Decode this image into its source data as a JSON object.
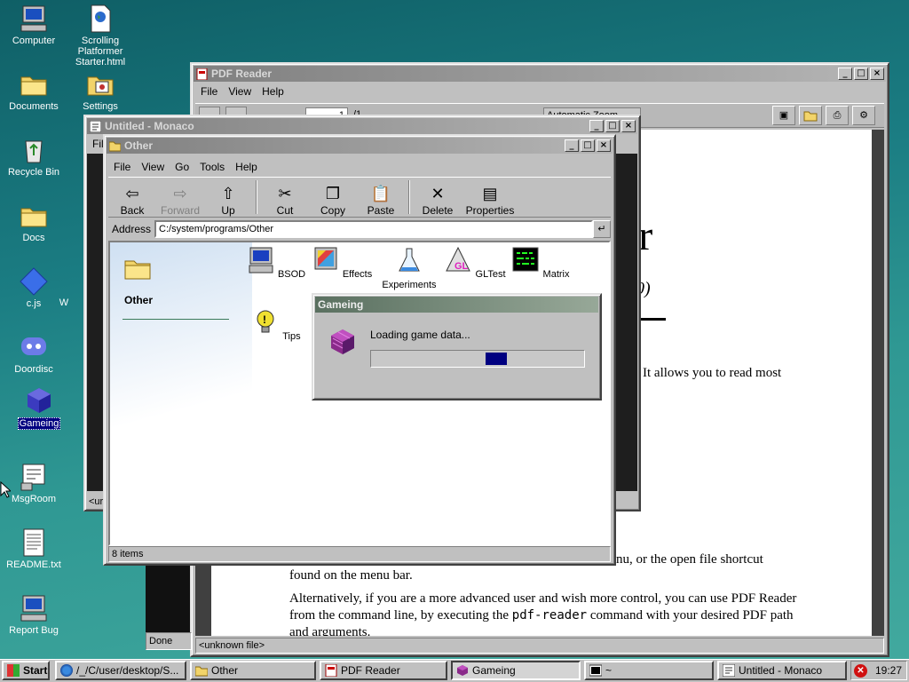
{
  "desktop": {
    "icons": [
      {
        "label": "Computer",
        "icon": "computer-icon"
      },
      {
        "label": "Scrolling Platformer Starter.html",
        "icon": "html-file-icon"
      },
      {
        "label": "Documents",
        "icon": "folder-icon"
      },
      {
        "label": "Settings",
        "icon": "settings-icon"
      },
      {
        "label": "Recycle Bin",
        "icon": "recycle-bin-icon"
      },
      {
        "label": "Docs",
        "icon": "folder-icon"
      },
      {
        "label": "c.js",
        "icon": "js-file-icon"
      },
      {
        "label": "Doordisc",
        "icon": "chat-icon"
      },
      {
        "label": "Gameing",
        "icon": "cube-icon"
      },
      {
        "label": "MsgRoom",
        "icon": "msgroom-icon"
      },
      {
        "label": "README.txt",
        "icon": "text-file-icon"
      },
      {
        "label": "Report Bug",
        "icon": "report-icon"
      }
    ],
    "partial_text": "W"
  },
  "pdf_reader": {
    "title": "PDF Reader",
    "menu": [
      "File",
      "View",
      "Help"
    ],
    "page_input": "1",
    "page_count": "/1",
    "zoom": "Automatic Zoom",
    "doc": {
      "big_title_fragment": "er",
      "subtitle_fragment": "0)",
      "line1": "It allows you to read most",
      "line2": "nu, or the open file shortcut",
      "line3": "found on the menu bar.",
      "para2_l1": "Alternatively, if you are a more advanced user and wish more control, you can use PDF Reader",
      "para2_l2a": "from the command line, by executing the ",
      "para2_code": "pdf-reader",
      "para2_l2b": " command with your desired PDF path",
      "para2_l3": "and arguments."
    },
    "status": "<unknown file>"
  },
  "monaco": {
    "title": "Untitled - Monaco",
    "menu_partial": "File",
    "status_partial": "<ur",
    "done": "Done"
  },
  "explorer": {
    "title": "Other",
    "menu": [
      "File",
      "View",
      "Go",
      "Tools",
      "Help"
    ],
    "toolbar": [
      {
        "label": "Back",
        "icon": "back-arrow-icon",
        "enabled": true
      },
      {
        "label": "Forward",
        "icon": "forward-arrow-icon",
        "enabled": false
      },
      {
        "label": "Up",
        "icon": "up-folder-icon",
        "enabled": true
      },
      {
        "label": "Cut",
        "icon": "scissors-icon",
        "enabled": true
      },
      {
        "label": "Copy",
        "icon": "copy-icon",
        "enabled": true
      },
      {
        "label": "Paste",
        "icon": "paste-icon",
        "enabled": true
      },
      {
        "label": "Delete",
        "icon": "delete-x-icon",
        "enabled": true
      },
      {
        "label": "Properties",
        "icon": "properties-icon",
        "enabled": true
      }
    ],
    "address_label": "Address",
    "address": "C:/system/programs/Other",
    "sidebar_title": "Other",
    "items": [
      {
        "label": "BSOD",
        "icon": "bsod-icon"
      },
      {
        "label": "Effects",
        "icon": "effects-icon"
      },
      {
        "label": "Experiments",
        "icon": "flask-icon"
      },
      {
        "label": "GLTest",
        "icon": "gl-icon"
      },
      {
        "label": "Matrix",
        "icon": "matrix-icon"
      },
      {
        "label": "Tips",
        "icon": "tips-icon"
      }
    ],
    "status": "8 items"
  },
  "loading_dialog": {
    "title": "Gameing",
    "message": "Loading game data...",
    "progress": 0.5
  },
  "taskbar": {
    "start": "Start",
    "tasks": [
      {
        "label": "/_/C/user/desktop/S...",
        "icon": "browser-icon"
      },
      {
        "label": "Other",
        "icon": "folder-icon"
      },
      {
        "label": "PDF Reader",
        "icon": "pdf-icon"
      },
      {
        "label": "Gameing",
        "icon": "cube-icon"
      },
      {
        "label": "~",
        "icon": "terminal-icon"
      },
      {
        "label": "Untitled - Monaco",
        "icon": "monaco-icon"
      }
    ],
    "clock": "19:27"
  },
  "colors": {
    "selection": "#000080",
    "progress": "#000080",
    "desktop": "#1b7d83"
  }
}
